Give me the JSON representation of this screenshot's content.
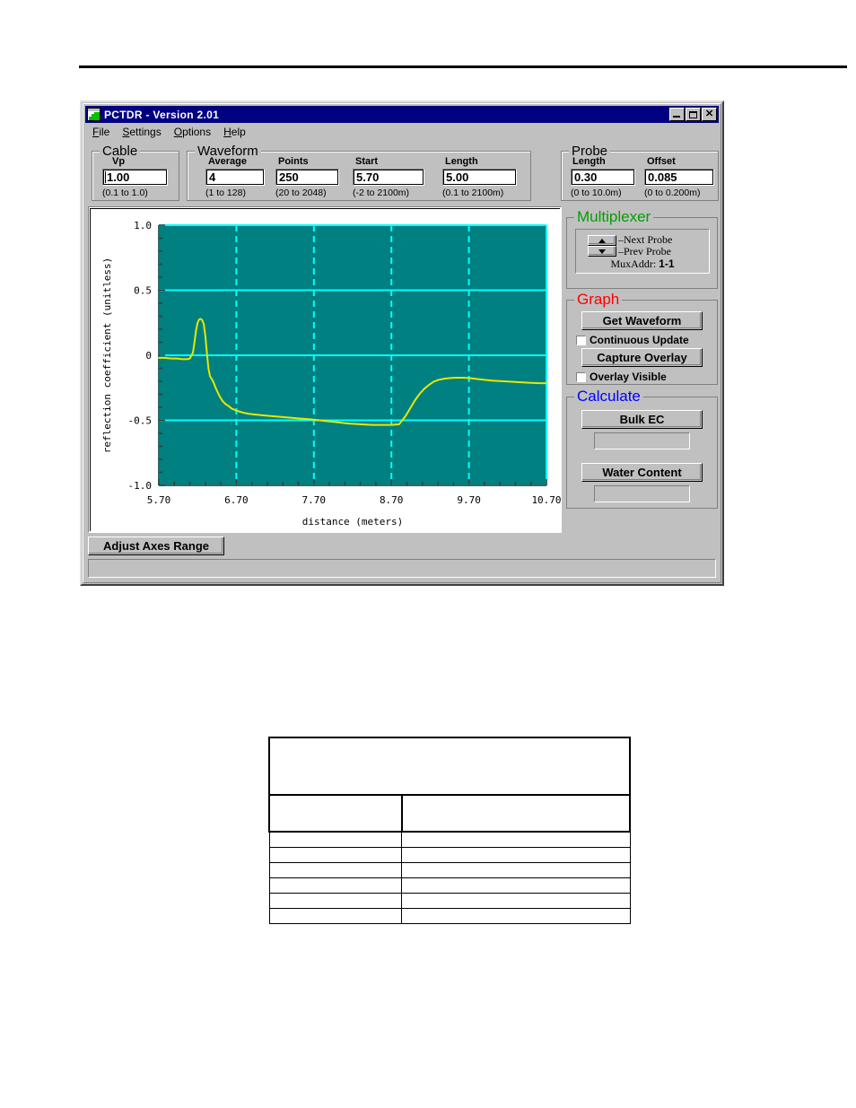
{
  "window": {
    "title": "PCTDR  -  Version 2.01",
    "icon": "waveform-icon",
    "buttons": {
      "minimize": "_",
      "maximize": "□",
      "close": "✕"
    }
  },
  "menu": [
    {
      "label": "File",
      "accel": "F"
    },
    {
      "label": "Settings",
      "accel": "S"
    },
    {
      "label": "Options",
      "accel": "O"
    },
    {
      "label": "Help",
      "accel": "H"
    }
  ],
  "groups": {
    "cable": {
      "legend": "Cable",
      "fields": [
        {
          "label": "Vp",
          "value": "1.00",
          "range": "(0.1 to 1.0)",
          "focused": true
        }
      ]
    },
    "waveform": {
      "legend": "Waveform",
      "fields": [
        {
          "label": "Average",
          "value": "4",
          "range": "(1 to 128)"
        },
        {
          "label": "Points",
          "value": "250",
          "range": "(20 to 2048)"
        },
        {
          "label": "Start",
          "value": "5.70",
          "range": "(-2 to 2100m)"
        },
        {
          "label": "Length",
          "value": "5.00",
          "range": "(0.1 to 2100m)"
        }
      ]
    },
    "probe": {
      "legend": "Probe",
      "fields": [
        {
          "label": "Length",
          "value": "0.30",
          "range": "(0 to 10.0m)"
        },
        {
          "label": "Offset",
          "value": "0.085",
          "range": "(0 to 0.200m)"
        }
      ]
    }
  },
  "multiplexer": {
    "legend": "Multiplexer",
    "legend_color": "#00a000",
    "next_probe_label": "–Next Probe",
    "prev_probe_label": "–Prev Probe",
    "up_icon": "triangle-up-icon",
    "down_icon": "triangle-down-icon",
    "muxaddr_label": "MuxAddr:",
    "muxaddr_value": "1-1"
  },
  "graph_panel": {
    "legend": "Graph",
    "legend_color": "#ff0000",
    "get_waveform_label": "Get Waveform",
    "continuous_update_label": "Continuous Update",
    "continuous_update_checked": false,
    "capture_overlay_label": "Capture Overlay",
    "overlay_visible_label": "Overlay Visible",
    "overlay_visible_checked": false
  },
  "calculate": {
    "legend": "Calculate",
    "legend_color": "#0000ff",
    "bulk_ec_label": "Bulk EC",
    "bulk_ec_value": "",
    "water_content_label": "Water Content",
    "water_content_value": ""
  },
  "adjust_axes_label": "Adjust Axes Range",
  "statusbar_text": "",
  "bottom_table": {
    "rows": [
      {
        "cells": [
          ""
        ],
        "span": 2,
        "height": 62,
        "thick": true
      },
      {
        "cells": [
          "",
          ""
        ],
        "height": 39,
        "thick": true
      },
      {
        "cells": [
          "",
          ""
        ],
        "height": 16
      },
      {
        "cells": [
          "",
          ""
        ],
        "height": 16
      },
      {
        "cells": [
          "",
          ""
        ],
        "height": 16
      },
      {
        "cells": [
          "",
          ""
        ],
        "height": 16
      },
      {
        "cells": [
          "",
          ""
        ],
        "height": 16
      },
      {
        "cells": [
          "",
          ""
        ],
        "height": 16
      }
    ]
  },
  "chart_data": {
    "type": "line",
    "title": "",
    "xlabel": "distance (meters)",
    "ylabel": "reflection coefficient (unitless)",
    "xlim": [
      5.7,
      10.7
    ],
    "ylim": [
      -1.0,
      1.0
    ],
    "xticks": [
      5.7,
      6.7,
      7.7,
      8.7,
      9.7,
      10.7
    ],
    "xticklabels": [
      "5.70",
      "6.70",
      "7.70",
      "8.70",
      "9.70",
      "10.70"
    ],
    "yticks": [
      -1.0,
      -0.5,
      0,
      0.5,
      1.0
    ],
    "yticklabels": [
      "-1.0",
      "-0.5",
      "0",
      "0.5",
      "1.0"
    ],
    "grid": true,
    "grid_color": "#00ffff",
    "plot_bg": "#008080",
    "line_color": "#e8e800",
    "legend": null,
    "series": [
      {
        "name": "reflection coefficient",
        "x": [
          5.7,
          5.78,
          5.86,
          5.94,
          6.0,
          6.06,
          6.1,
          6.14,
          6.16,
          6.18,
          6.2,
          6.22,
          6.24,
          6.26,
          6.28,
          6.3,
          6.32,
          6.34,
          6.36,
          6.4,
          6.44,
          6.48,
          6.52,
          6.56,
          6.6,
          6.64,
          6.7,
          6.78,
          6.86,
          6.94,
          7.02,
          7.1,
          7.2,
          7.3,
          7.4,
          7.5,
          7.6,
          7.7,
          7.85,
          8.0,
          8.15,
          8.3,
          8.45,
          8.6,
          8.7,
          8.8,
          8.88,
          8.94,
          9.0,
          9.06,
          9.12,
          9.18,
          9.24,
          9.3,
          9.38,
          9.46,
          9.54,
          9.62,
          9.7,
          9.85,
          10.0,
          10.15,
          10.3,
          10.45,
          10.6,
          10.7
        ],
        "y": [
          -0.02,
          -0.02,
          -0.025,
          -0.025,
          -0.03,
          -0.03,
          -0.025,
          0.02,
          0.1,
          0.19,
          0.25,
          0.275,
          0.28,
          0.27,
          0.24,
          0.15,
          0.02,
          -0.1,
          -0.16,
          -0.2,
          -0.26,
          -0.31,
          -0.35,
          -0.375,
          -0.39,
          -0.41,
          -0.425,
          -0.44,
          -0.45,
          -0.455,
          -0.46,
          -0.465,
          -0.47,
          -0.475,
          -0.48,
          -0.485,
          -0.49,
          -0.495,
          -0.505,
          -0.515,
          -0.525,
          -0.53,
          -0.535,
          -0.535,
          -0.535,
          -0.53,
          -0.47,
          -0.41,
          -0.35,
          -0.3,
          -0.26,
          -0.23,
          -0.205,
          -0.19,
          -0.18,
          -0.175,
          -0.172,
          -0.172,
          -0.175,
          -0.185,
          -0.195,
          -0.2,
          -0.205,
          -0.21,
          -0.215,
          -0.215
        ]
      }
    ]
  }
}
